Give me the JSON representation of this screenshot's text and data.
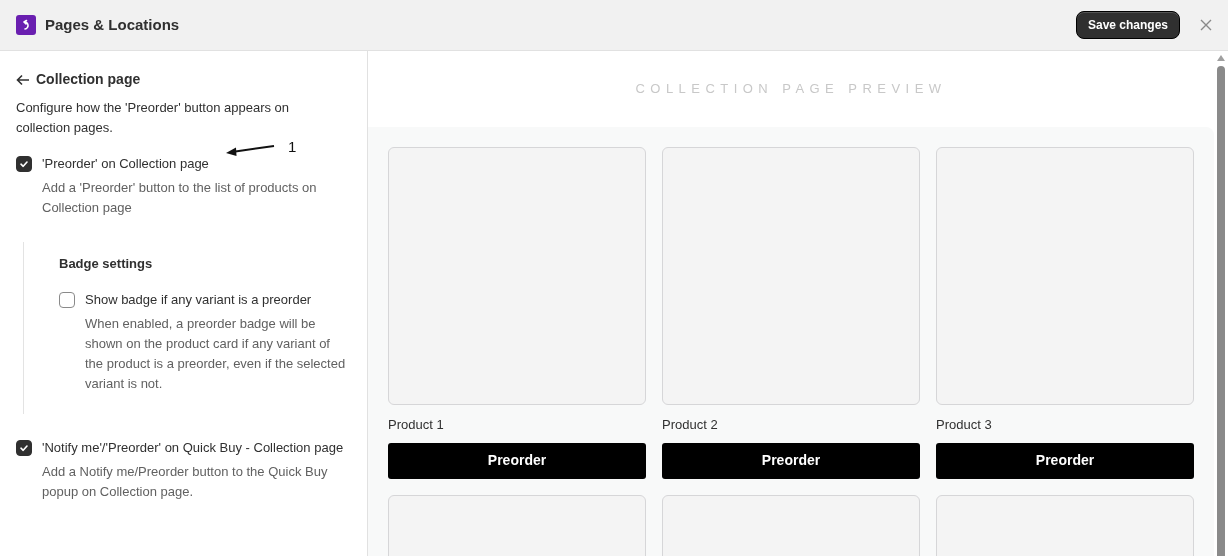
{
  "window": {
    "title": "Pages & Locations",
    "save_button": "Save changes"
  },
  "settings": {
    "back_title": "Collection page",
    "description": "Configure how the 'Preorder' button appears on collection pages.",
    "options": [
      {
        "label": "'Preorder' on Collection page",
        "help": "Add a 'Preorder' button to the list of products on Collection page",
        "checked": true,
        "annotation": "1",
        "sub_section": {
          "title": "Badge settings",
          "options": [
            {
              "label": "Show badge if any variant is a preorder",
              "help": "When enabled, a preorder badge will be shown on the product card if any variant of the product is a preorder, even if the selected variant is not.",
              "checked": false
            }
          ]
        }
      },
      {
        "label": "'Notify me'/'Preorder' on Quick Buy - Collection page",
        "help": "Add a Notify me/Preorder button to the Quick Buy popup on Collection page.",
        "checked": true
      }
    ]
  },
  "preview": {
    "title": "COLLECTION PAGE PREVIEW",
    "products": [
      {
        "kind": "full",
        "name": "Product 1",
        "button": "Preorder"
      },
      {
        "kind": "full",
        "name": "Product 2",
        "button": "Preorder"
      },
      {
        "kind": "full",
        "name": "Product 3",
        "button": "Preorder"
      },
      {
        "kind": "image_only"
      },
      {
        "kind": "image_only"
      },
      {
        "kind": "image_only"
      }
    ]
  }
}
